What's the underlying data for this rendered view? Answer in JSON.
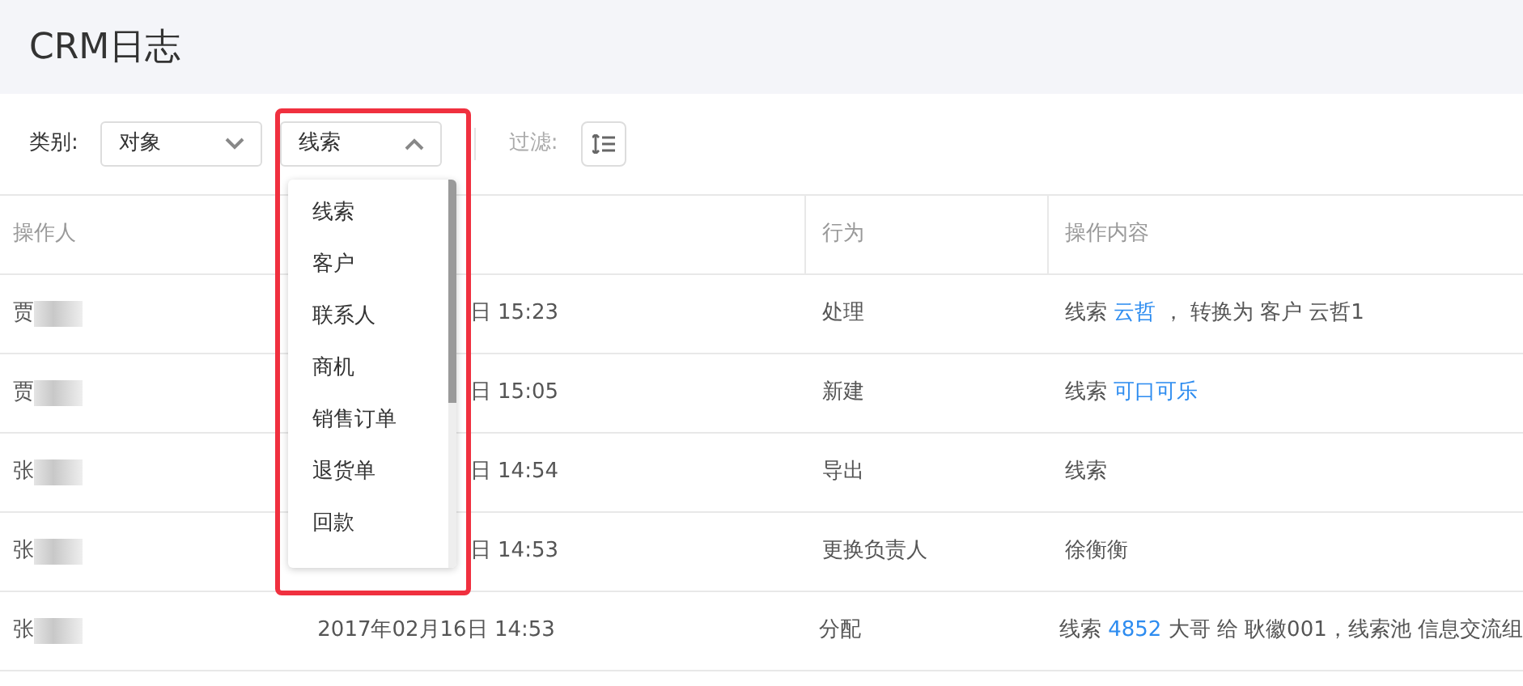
{
  "page_title": "CRM日志",
  "toolbar": {
    "category_label": "类别:",
    "selects": [
      {
        "value": "对象",
        "expanded": false
      },
      {
        "value": "线索",
        "expanded": true
      }
    ],
    "filter_label": "过滤:"
  },
  "dropdown": {
    "options": [
      {
        "label": "线索"
      },
      {
        "label": "客户"
      },
      {
        "label": "联系人"
      },
      {
        "label": "商机"
      },
      {
        "label": "销售订单"
      },
      {
        "label": "退货单"
      },
      {
        "label": "回款"
      }
    ]
  },
  "table": {
    "columns": [
      {
        "label": "操作人"
      },
      {},
      {
        "label": "行为"
      },
      {
        "label": "操作内容"
      }
    ],
    "rows": [
      {
        "operator": "贾",
        "time": "日 15:23",
        "action": "处理",
        "content": [
          {
            "text": "线索 ",
            "link": false
          },
          {
            "text": "云哲",
            "link": true
          },
          {
            "text": " ， 转换为 客户 云哲1",
            "link": false
          }
        ]
      },
      {
        "operator": "贾",
        "time": "日 15:05",
        "action": "新建",
        "content": [
          {
            "text": "线索 ",
            "link": false
          },
          {
            "text": "可口可乐",
            "link": true
          }
        ]
      },
      {
        "operator": "张",
        "time": "日 14:54",
        "action": "导出",
        "content": [
          {
            "text": "线索",
            "link": false
          }
        ]
      },
      {
        "operator": "张",
        "time": "日 14:53",
        "action": "更换负责人",
        "content": [
          {
            "text": "徐衡衡",
            "link": false
          }
        ]
      },
      {
        "operator": "张",
        "time": "2017年02月16日 14:53",
        "action": "分配",
        "content": [
          {
            "text": "线索 ",
            "link": false
          },
          {
            "text": "4852",
            "link": true
          },
          {
            "text": " 大哥 给 耿徽001，线索池 信息交流组",
            "link": false
          }
        ]
      }
    ]
  }
}
